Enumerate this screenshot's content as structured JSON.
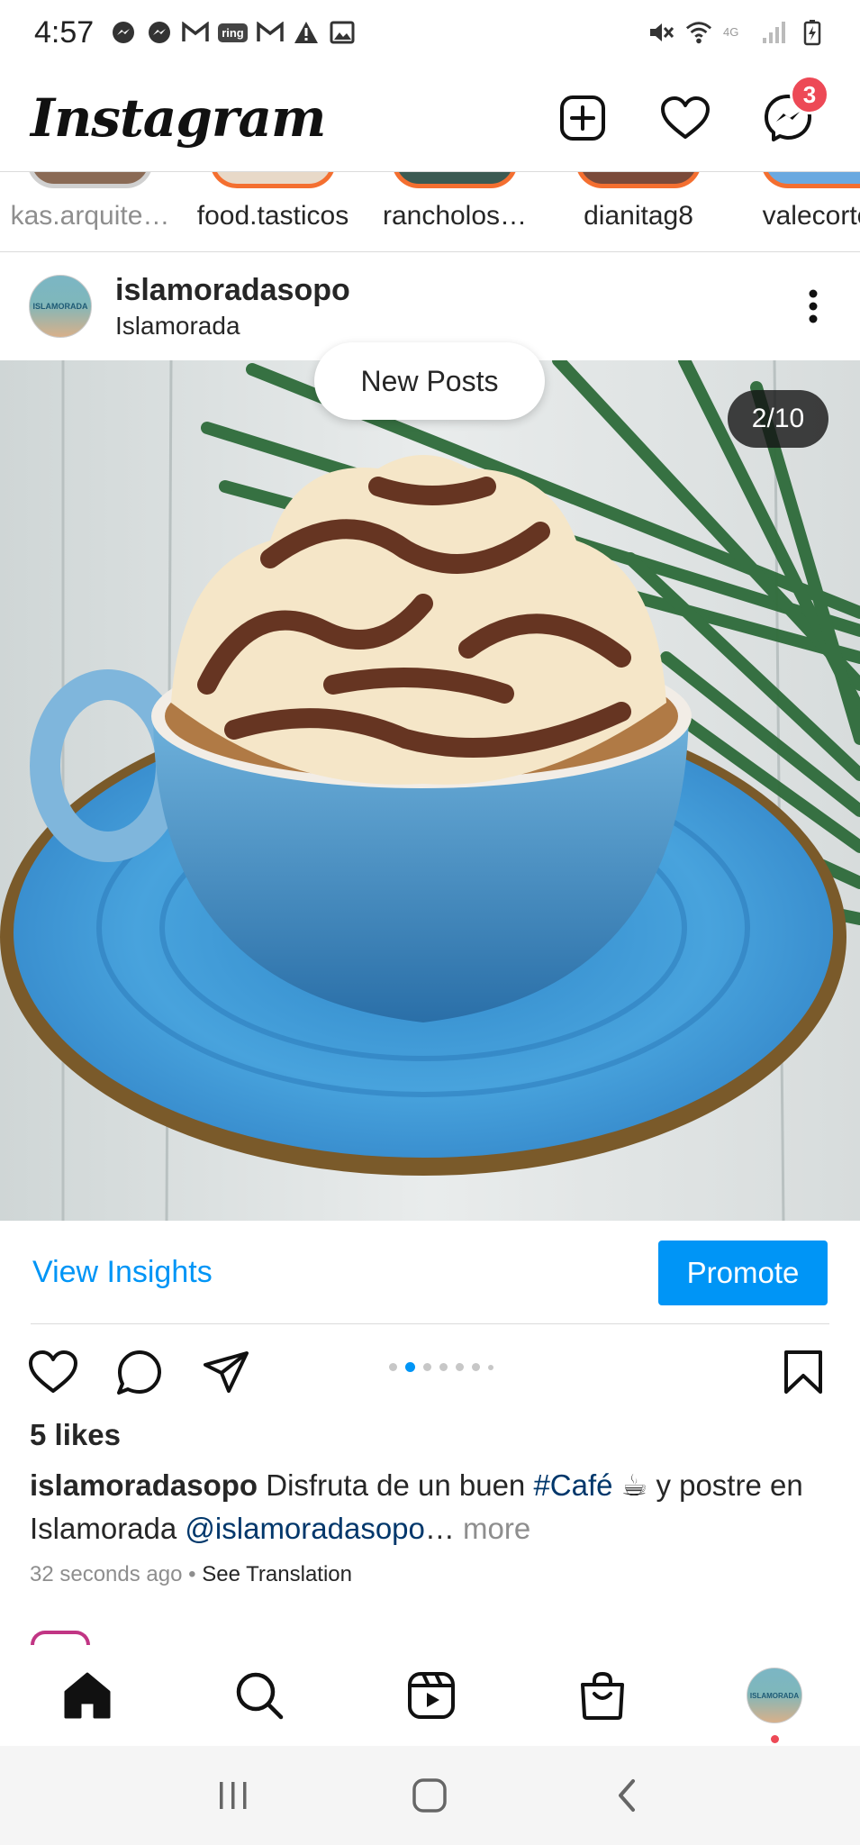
{
  "status_bar": {
    "time": "4:57",
    "ring_label": "ring"
  },
  "header": {
    "logo": "Instagram",
    "messages_badge": "3"
  },
  "stories": [
    {
      "name": "kas.arquite…",
      "seen": true
    },
    {
      "name": "food.tasticos",
      "seen": false
    },
    {
      "name": "rancholos…",
      "seen": false
    },
    {
      "name": "dianitag8",
      "seen": false
    },
    {
      "name": "valecortes",
      "seen": false
    }
  ],
  "post": {
    "username": "islamoradasopo",
    "location": "Islamorada",
    "avatar_text": "ISLAMORADA",
    "new_posts_label": "New Posts",
    "page_counter": "2/10",
    "carousel_total": 10,
    "carousel_index": 2,
    "view_insights_label": "View Insights",
    "promote_label": "Promote",
    "likes": "5 likes",
    "caption_user": "islamoradasopo",
    "caption_text_1": " Disfruta de un buen ",
    "caption_hashtag": "#Café",
    "caption_emoji": " ☕ ",
    "caption_text_2": "y postre en Islamorada ",
    "caption_mention": "@islamoradasopo",
    "caption_ellipsis": "…",
    "caption_more": " more",
    "timestamp": "32 seconds ago",
    "meta_separator": " • ",
    "see_translation": "See Translation"
  },
  "bottom_nav": {
    "avatar_text": "ISLAMORADA"
  },
  "colors": {
    "accent_blue": "#0095f6",
    "badge_red": "#ed4956",
    "link_dark_blue": "#00376b",
    "saucer_blue": "#3d9ad6"
  },
  "icons": {
    "header": [
      "new-post-icon",
      "activity-heart-icon",
      "messenger-icon"
    ],
    "actions": [
      "like-heart-icon",
      "comment-icon",
      "share-icon",
      "save-bookmark-icon"
    ],
    "nav": [
      "home-icon",
      "search-icon",
      "reels-icon",
      "shop-icon",
      "profile-avatar"
    ],
    "system": [
      "recents-icon",
      "home-button-icon",
      "back-icon"
    ]
  }
}
